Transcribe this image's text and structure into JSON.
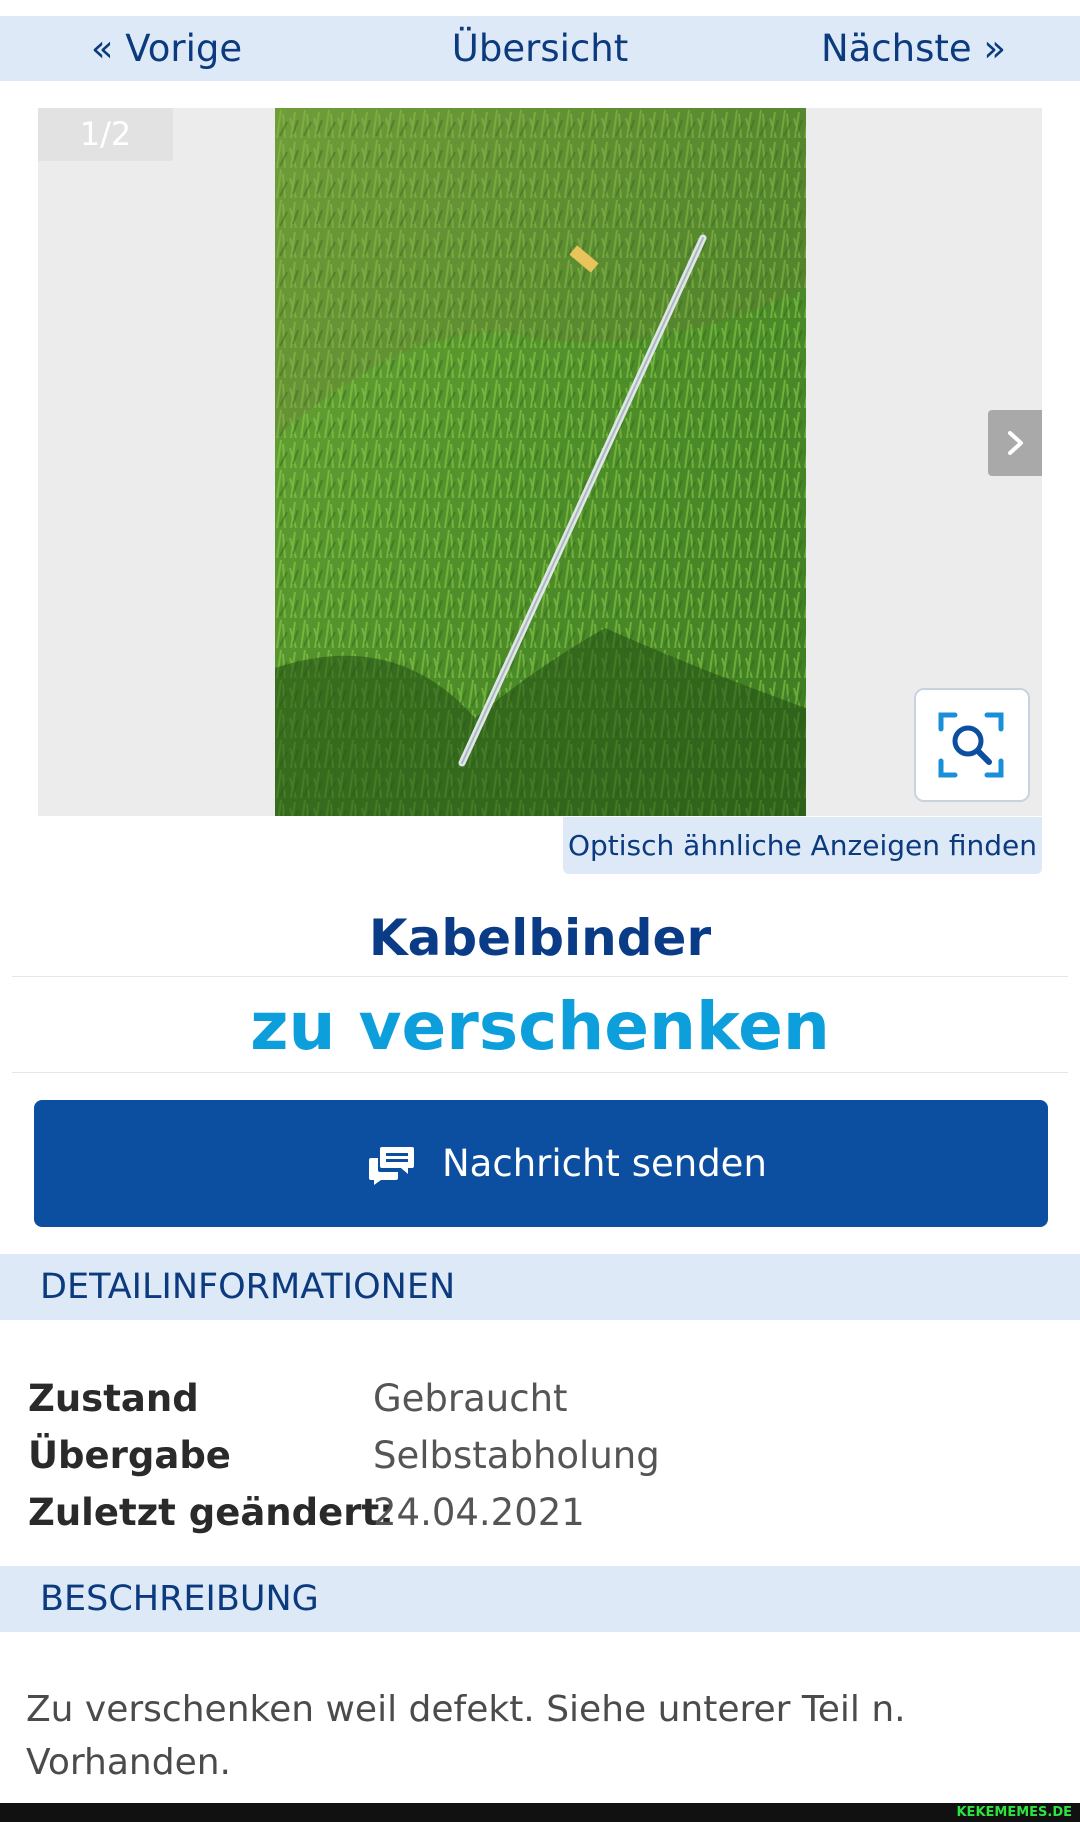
{
  "nav": {
    "prev": "« Vorige",
    "overview": "Übersicht",
    "next": "Nächste »"
  },
  "gallery": {
    "counter": "1/2",
    "similar_label": "Optisch ähnliche Anzeigen finden"
  },
  "listing": {
    "title": "Kabelbinder",
    "price": "zu verschenken"
  },
  "message_button": {
    "label": "Nachricht senden"
  },
  "details": {
    "heading": "DETAILINFORMATIONEN",
    "rows": [
      {
        "label": "Zustand",
        "value": "Gebraucht"
      },
      {
        "label": "Übergabe",
        "value": "Selbstabholung"
      },
      {
        "label": "Zuletzt geändert:",
        "value": "24.04.2021"
      }
    ]
  },
  "description": {
    "heading": "BESCHREIBUNG",
    "text": "Zu verschenken weil defekt. Siehe unterer Teil n. Vorhanden."
  },
  "watermark": "KEKEMEMES.DE",
  "colors": {
    "nav_bg": "#dde9f7",
    "title": "#0a3b86",
    "price": "#0d9fdc",
    "button": "#0c4fa0"
  }
}
